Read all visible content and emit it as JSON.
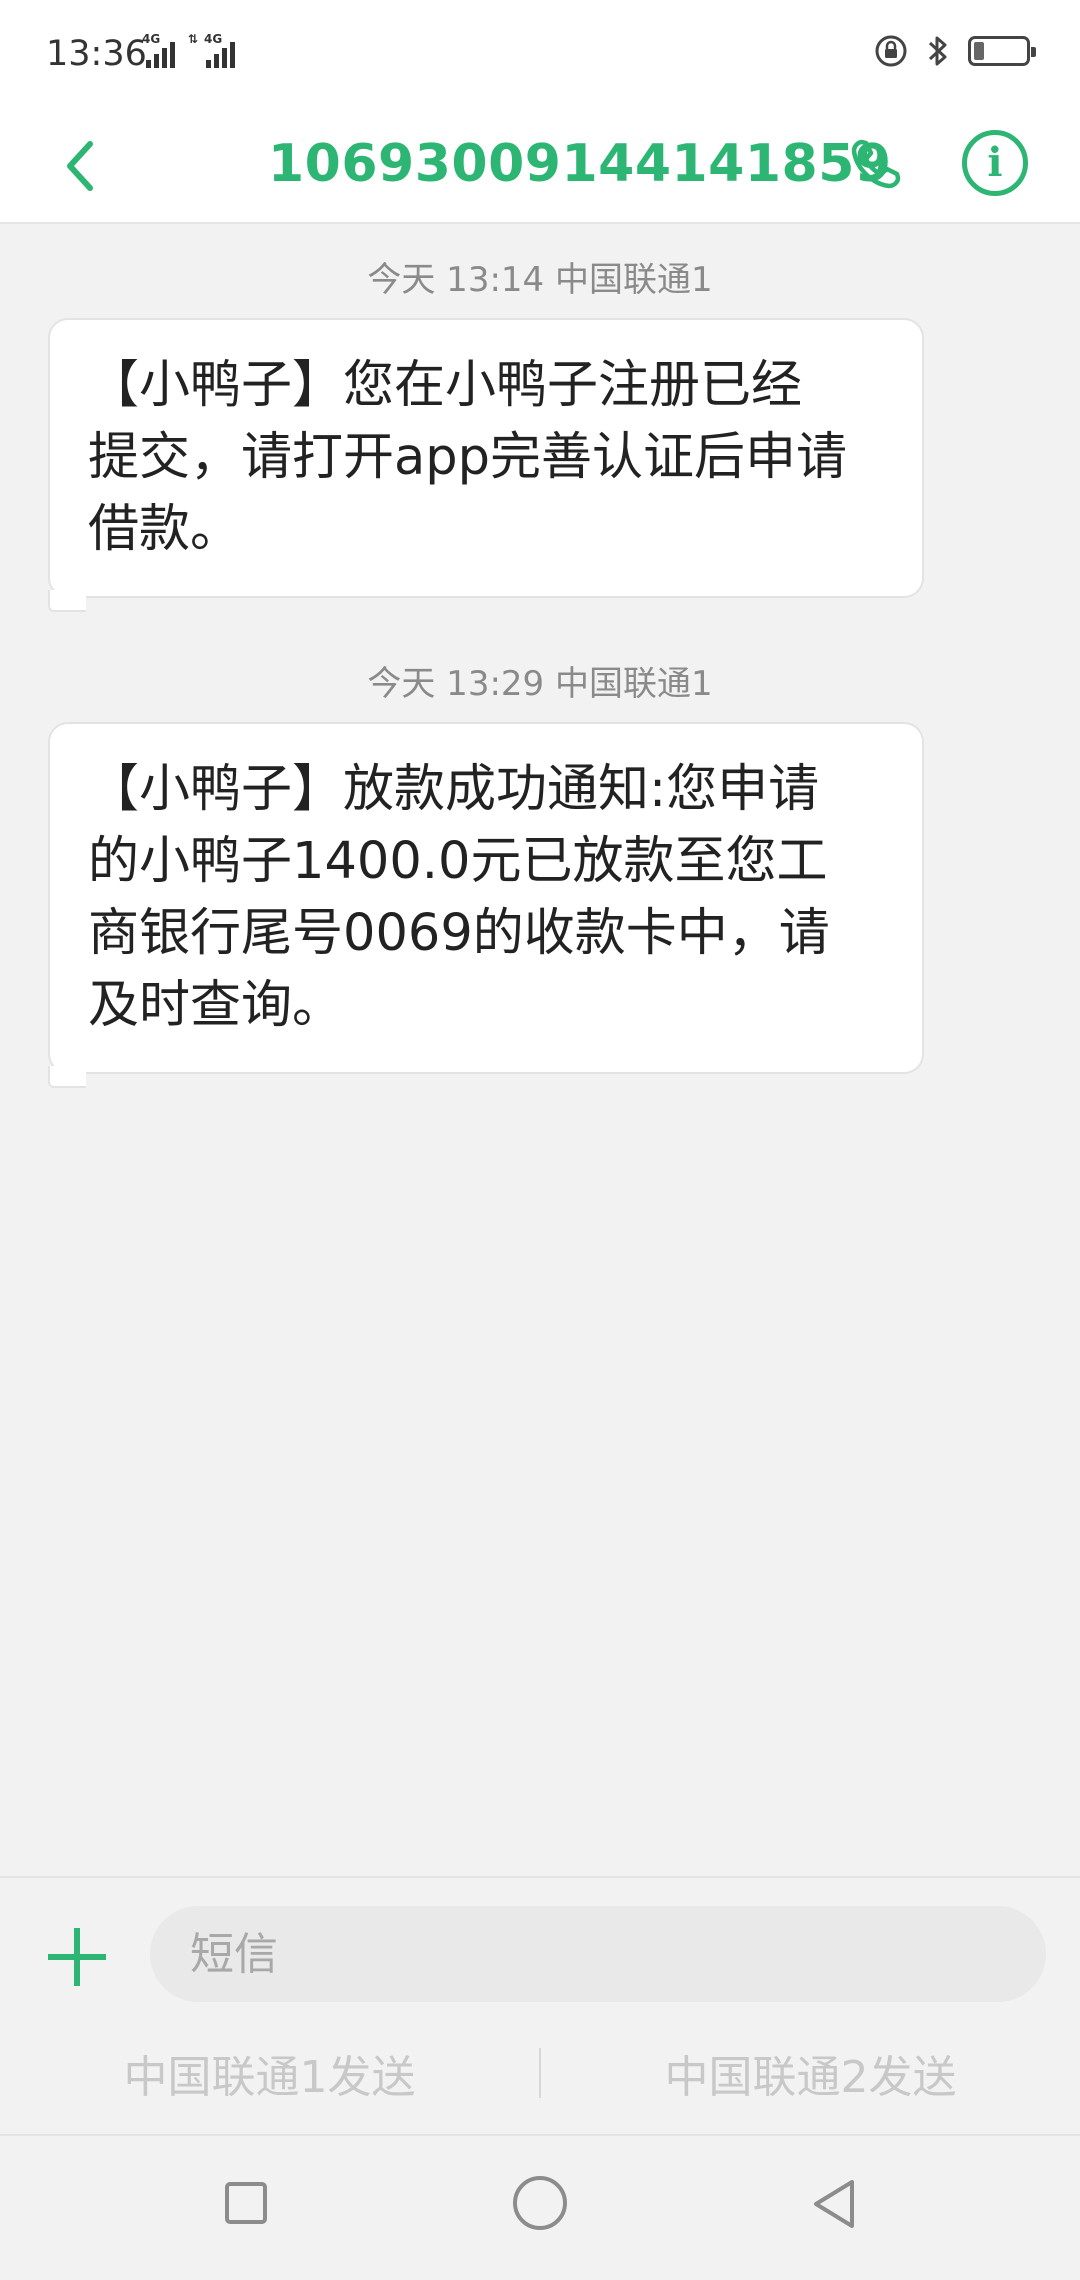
{
  "status_bar": {
    "time": "13:36",
    "signal_tags": [
      "4G",
      "4G"
    ],
    "icons": [
      "lock-rotation-icon",
      "bluetooth-icon",
      "battery-icon"
    ],
    "battery_level": 0.2
  },
  "header": {
    "sender": "10693009144141859",
    "icons": [
      "chevron-left-icon",
      "phone-icon",
      "info-icon"
    ],
    "info_glyph": "i"
  },
  "messages": [
    {
      "time": "今天 13:14  中国联通1",
      "lines": [
        "【小鸭子】您在小鸭子注册已经",
        "提交，请打开app完善认证后申请",
        "借款。"
      ]
    },
    {
      "time": "今天 13:29  中国联通1",
      "lines": [
        "【小鸭子】放款成功通知:您申请",
        "的小鸭子1400.0元已放款至您工",
        "商银行尾号0069的收款卡中，请",
        "及时查询。"
      ]
    }
  ],
  "composer": {
    "placeholder": "短信",
    "send_sim1": "中国联通1发送",
    "send_sim2": "中国联通2发送"
  },
  "colors": {
    "accent": "#2db573",
    "background": "#f2f2f2",
    "bubble": "#ffffff",
    "meta_text": "#8a8a8a"
  }
}
